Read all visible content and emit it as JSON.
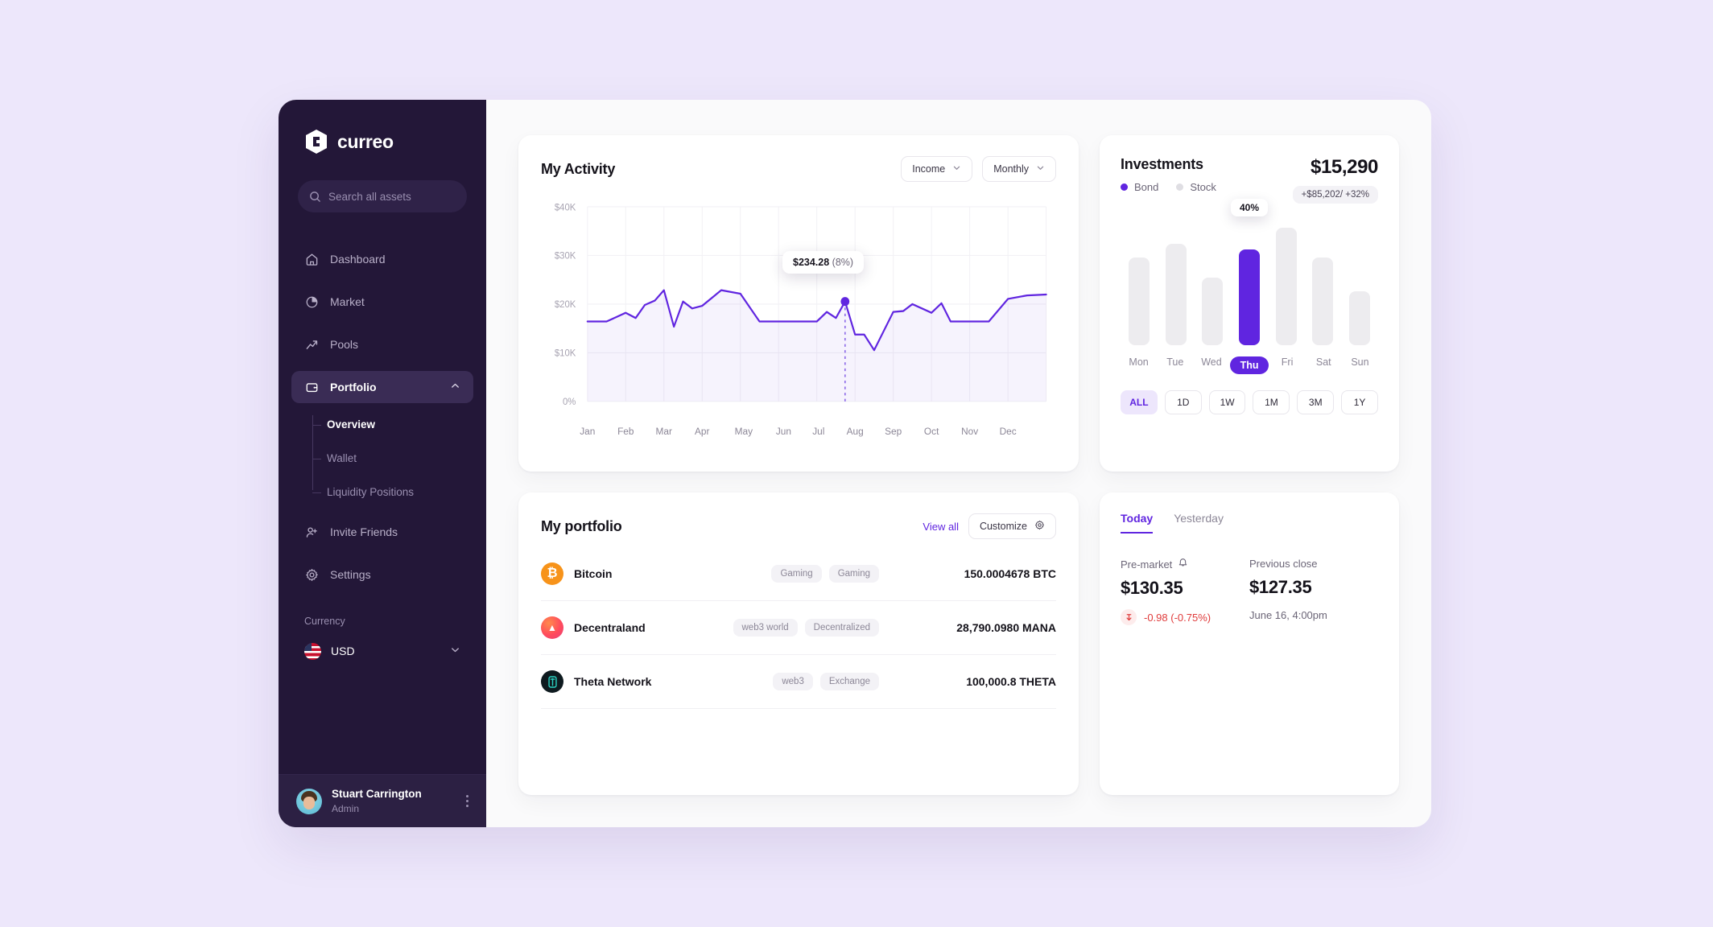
{
  "brand": {
    "name": "curreo",
    "logo_icon": "cube-logo-icon"
  },
  "sidebar": {
    "search": {
      "placeholder": "Search all assets",
      "icon": "search-icon"
    },
    "items": [
      {
        "label": "Dashboard",
        "icon": "home-icon",
        "active": false
      },
      {
        "label": "Market",
        "icon": "pie-chart-icon",
        "active": false
      },
      {
        "label": "Pools",
        "icon": "trend-arrow-icon",
        "active": false
      },
      {
        "label": "Portfolio",
        "icon": "wallet-icon",
        "active": true,
        "chevron": "chevron-up-icon"
      },
      {
        "label": "Invite Friends",
        "icon": "user-plus-icon",
        "active": false
      },
      {
        "label": "Settings",
        "icon": "gear-icon",
        "active": false
      }
    ],
    "sub_items": [
      {
        "label": "Overview",
        "active": true
      },
      {
        "label": "Wallet",
        "active": false
      },
      {
        "label": "Liquidity Positions",
        "active": false
      }
    ],
    "currency": {
      "label": "Currency",
      "value": "USD",
      "flag": "us-flag-icon",
      "chevron": "chevron-down-icon"
    },
    "profile": {
      "name": "Stuart Carrington",
      "role": "Admin",
      "menu_icon": "kebab-menu-icon"
    }
  },
  "activity": {
    "title": "My Activity",
    "filters": [
      {
        "label": "Income",
        "icon": "chevron-down-icon"
      },
      {
        "label": "Monthly",
        "icon": "chevron-down-icon"
      }
    ],
    "tooltip": {
      "value": "$234.28",
      "percent": "(8%)"
    }
  },
  "investments": {
    "title": "Investments",
    "amount": "$15,290",
    "badge": "+$85,202/ +32%",
    "legend": [
      {
        "label": "Bond",
        "color": "#6025E0"
      },
      {
        "label": "Stock",
        "color": "#DFDEE3"
      }
    ],
    "bar_tooltip": "40%",
    "ranges": [
      {
        "label": "ALL",
        "active": true
      },
      {
        "label": "1D",
        "active": false
      },
      {
        "label": "1W",
        "active": false
      },
      {
        "label": "1M",
        "active": false
      },
      {
        "label": "3M",
        "active": false
      },
      {
        "label": "1Y",
        "active": false
      }
    ]
  },
  "portfolio": {
    "title": "My portfolio",
    "view_all": "View all",
    "customize": {
      "label": "Customize",
      "icon": "gear-icon"
    },
    "rows": [
      {
        "name": "Bitcoin",
        "symbol": "₿",
        "color": "#F7931A",
        "tags": [
          "Gaming",
          "Gaming"
        ],
        "amount": "150.0004678 BTC"
      },
      {
        "name": "Decentraland",
        "symbol": "▲",
        "color": "#FF4B5C",
        "tags": [
          "web3 world",
          "Decentralized"
        ],
        "amount": "28,790.0980 MANA"
      },
      {
        "name": "Theta Network",
        "symbol": "⬛",
        "color": "#0E1A1F",
        "tags": [
          "web3",
          "Exchange"
        ],
        "amount": "100,000.8 THETA"
      }
    ]
  },
  "market": {
    "tabs": [
      {
        "label": "Today",
        "active": true
      },
      {
        "label": "Yesterday",
        "active": false
      }
    ],
    "premarket": {
      "label": "Pre-market",
      "bell_icon": "bell-icon",
      "value": "$130.35",
      "change": "-0.98 (-0.75%)",
      "change_icon": "arrow-down-icon",
      "change_color": "#E03B3B"
    },
    "previous_close": {
      "label": "Previous close",
      "value": "$127.35",
      "timestamp": "June 16, 4:00pm"
    }
  },
  "chart_data": [
    {
      "type": "line",
      "title": "My Activity",
      "xlabel": "",
      "ylabel": "",
      "categories": [
        "Jan",
        "Feb",
        "Mar",
        "Apr",
        "May",
        "Jun",
        "Jul",
        "Aug",
        "Sep",
        "Oct",
        "Nov",
        "Dec"
      ],
      "ytick_labels": [
        "$40K",
        "$30K",
        "$20K",
        "$10K",
        "0%"
      ],
      "ylim": [
        0,
        40000
      ],
      "grid": true,
      "legend": "none",
      "line_color": "#6025E0",
      "marker": {
        "x_label": "Aug",
        "value": 21500,
        "tooltip": "$234.28 (8%)"
      },
      "x": [
        0,
        0.5,
        1,
        1.5,
        2,
        2.3,
        2.6,
        3,
        3.3,
        3.6,
        4,
        4.4,
        4.8,
        5,
        5.5,
        6,
        6.4,
        6.8,
        7,
        7.3,
        7.6,
        8,
        8.4,
        8.8,
        9,
        9.4,
        9.8,
        10,
        10.5,
        11
      ],
      "values": [
        16400,
        16400,
        18200,
        17000,
        19600,
        20400,
        22600,
        15200,
        20200,
        18800,
        19200,
        22600,
        21800,
        16400,
        16400,
        16400,
        19400,
        18200,
        21500,
        13600,
        13600,
        10400,
        17900,
        18100,
        20000,
        18000,
        19900,
        16400,
        16400,
        21100
      ]
    },
    {
      "type": "bar",
      "title": "Investments",
      "categories": [
        "Mon",
        "Tue",
        "Wed",
        "Thu",
        "Fri",
        "Sat",
        "Sun"
      ],
      "values": [
        72,
        83,
        55,
        78,
        96,
        72,
        44
      ],
      "selected_index": 3,
      "selected_label": "40%",
      "ylim": [
        0,
        100
      ],
      "grid": false,
      "legend": "top",
      "series": [
        {
          "name": "Bond",
          "color": "#6025E0"
        },
        {
          "name": "Stock",
          "color": "#DFDEE3"
        }
      ]
    }
  ]
}
